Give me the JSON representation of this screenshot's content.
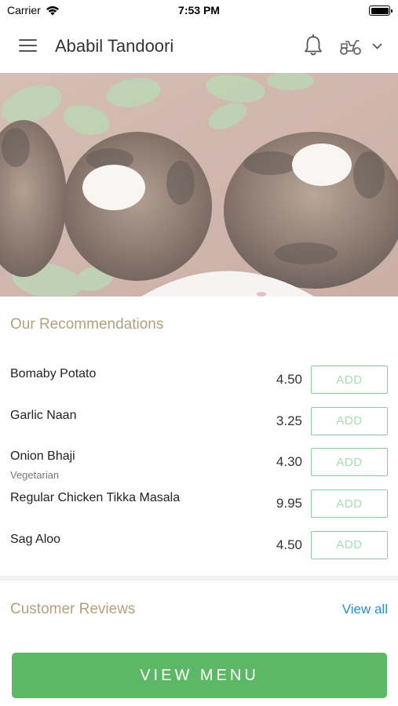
{
  "status_bar": {
    "carrier": "Carrier",
    "time": "7:53 PM"
  },
  "header": {
    "title": "Ababil Tandoori",
    "icons": [
      "menu-icon",
      "bell-icon",
      "delivery-icon",
      "chevron-down-icon"
    ]
  },
  "recommendations": {
    "title": "Our Recommendations",
    "items": [
      {
        "name": "Bomaby Potato",
        "subtitle": "",
        "price": "4.50",
        "button": "ADD"
      },
      {
        "name": "Garlic Naan",
        "subtitle": "",
        "price": "3.25",
        "button": "ADD"
      },
      {
        "name": "Onion Bhaji",
        "subtitle": "Vegetarian",
        "price": "4.30",
        "button": "ADD"
      },
      {
        "name": "Regular Chicken Tikka Masala",
        "subtitle": "",
        "price": "9.95",
        "button": "ADD"
      },
      {
        "name": "Sag Aloo",
        "subtitle": "",
        "price": "4.50",
        "button": "ADD"
      }
    ]
  },
  "reviews": {
    "title": "Customer Reviews",
    "view_all": "View all"
  },
  "footer": {
    "view_menu": "VIEW MENU"
  },
  "colors": {
    "section_title": "#b59f7e",
    "add_border": "#8ccf9b",
    "link": "#2a8fc0",
    "primary_button": "#5cb865"
  }
}
